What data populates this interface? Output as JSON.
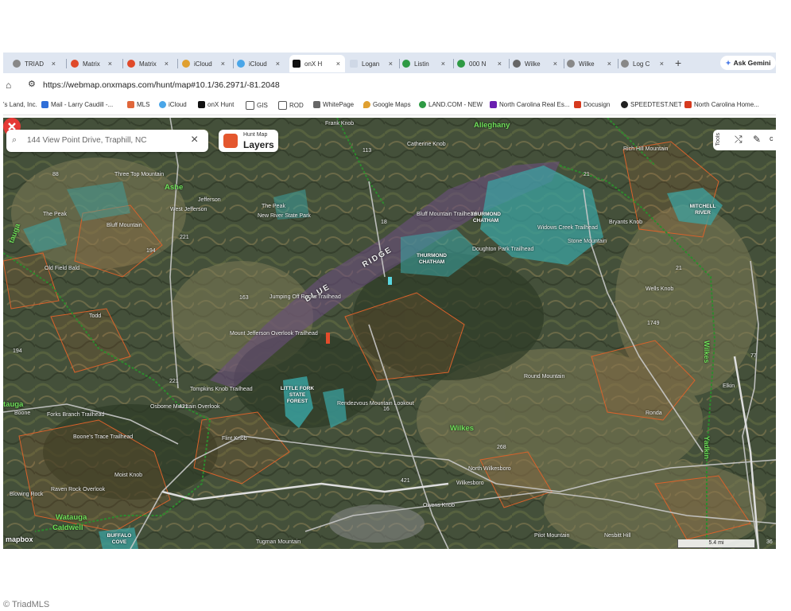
{
  "browser": {
    "tabs": [
      {
        "label": "TRIAD",
        "active": false
      },
      {
        "label": "Matrix",
        "active": false
      },
      {
        "label": "Matrix",
        "active": false
      },
      {
        "label": "iCloud",
        "active": false
      },
      {
        "label": "iCloud",
        "active": false
      },
      {
        "label": "onX H",
        "active": true
      },
      {
        "label": "Logan",
        "active": false
      },
      {
        "label": "Listin",
        "active": false
      },
      {
        "label": "000 N",
        "active": false
      },
      {
        "label": "Wilke",
        "active": false
      },
      {
        "label": "Wilke",
        "active": false
      },
      {
        "label": "Log C",
        "active": false
      }
    ],
    "new_tab_glyph": "+",
    "close_glyph": "×",
    "gemini_label": "Ask Gemini",
    "url": "https://webmap.onxmaps.com/hunt/map#10.1/36.2971/-81.2048",
    "bookmarks": [
      "'s Land, Inc.",
      "Mail - Larry Caudill -...",
      "MLS",
      "iCloud",
      "onX Hunt",
      "GIS",
      "ROD",
      "WhitePage",
      "Google Maps",
      "LAND.COM - NEW",
      "North Carolina Real Es...",
      "Docusign",
      "SPEEDTEST.NET",
      "North Carolina Home..."
    ]
  },
  "map": {
    "search_value": "144 View Point Drive, Traphill, NC",
    "layers_small": "Hunt Map",
    "layers_main": "Layers",
    "tools_label": "Tools",
    "logo": "mapbox",
    "scale_label": "5.4 mi",
    "scale_right": "36",
    "counties": {
      "alleghany": "Alleghany",
      "ashe": "Ashe",
      "wilkes": "Wilkes",
      "watauga": "Watauga",
      "caldwell": "Caldwell",
      "wilkes_vert": "Wilkes",
      "yadkin_vert": "Yadkin",
      "watauga_left": "tauga",
      "watauga_side": "tauga"
    },
    "ridge_1": "RIDGE",
    "ridge_2": "BLUE",
    "parks": {
      "thurmond_1": "THURMOND CHATHAM",
      "thurmond_2": "THURMOND CHATHAM",
      "mitchell": "MITCHELL RIVER",
      "little_fork": "LITTLE FORK STATE FOREST",
      "buffalo": "BUFFALO COVE"
    },
    "towns": {
      "west_jefferson": "West Jefferson",
      "jefferson": "Jefferson",
      "boone": "Boone",
      "elkin": "Elkin",
      "north_wilkesboro": "North Wilkesboro",
      "wilkesboro": "Wilkesboro",
      "blowing_rock": "Blowing Rock",
      "todd": "Todd",
      "ronda": "Ronda"
    },
    "features": {
      "frank_knob": "Frank Knob",
      "catherine_knob": "Catherine Knob",
      "bluff_mountain_trailhead": "Bluff Mountain Trailhead",
      "widows_creek_trailhead": "Widows Creek Trailhead",
      "doughton_park_trailhead": "Doughton Park Trailhead",
      "stone_mountain": "Stone Mountain",
      "three_top_mountain": "Three Top Mountain",
      "the_peak_1": "The Peak",
      "the_peak_2": "The Peak",
      "bluff_mountain": "Bluff Mountain",
      "old_field_bald": "Old Field Bald",
      "round_mountain": "Round Mountain",
      "rendezvous_mountain": "Rendezvous Mountain Lookout",
      "flint_knob": "Flint Knob",
      "moist_knob": "Moist Knob",
      "owens_knob": "Owens Knob",
      "pilot_mountain": "Pilot Mountain",
      "nesbitt_hill": "Nesbitt Hill",
      "tugman_mountain": "Tugman Mountain",
      "rich_hill_mountain": "Rich Hill Mountain",
      "bryants_knob": "Bryants Knob",
      "wells_knob": "Wells Knob",
      "jumping_off_rocks": "Jumping Off Rocks Trailhead",
      "mount_jefferson": "Mount Jefferson Overlook Trailhead",
      "tompkins_knob": "Tompkins Knob Trailhead",
      "osborne_mountain": "Osborne Mountain Overlook",
      "boones_trace": "Boone's Trace Trailhead",
      "forks_branch": "Forks Branch Trailhead",
      "raven_rock": "Raven Rock Overlook",
      "new_river_state_park": "New River State Park"
    },
    "roads": {
      "r113": "113",
      "r18": "18",
      "r21": "21",
      "r163": "163",
      "r221": "221",
      "r421": "421",
      "r16": "16",
      "r268": "268",
      "r77": "77",
      "r1749": "1749",
      "r88": "88",
      "r194": "194",
      "r194b": "194"
    }
  },
  "footer": {
    "credit": "© TriadMLS"
  },
  "colors": {
    "map_base": "#3f4a33",
    "hunt_outline": "#d9622b",
    "park_fill": "#3aa6a6",
    "forest_fill": "#6b4f7d",
    "county_line": "#2e8a2e",
    "marker": "#e53935"
  }
}
